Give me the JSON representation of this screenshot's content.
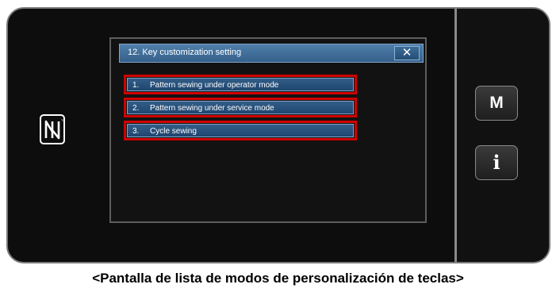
{
  "dialog": {
    "title": "12.  Key customization setting",
    "close_label": "✕"
  },
  "items": [
    {
      "number": "1.",
      "label": "Pattern sewing under operator mode"
    },
    {
      "number": "2.",
      "label": "Pattern sewing under service mode"
    },
    {
      "number": "3.",
      "label": "Cycle sewing"
    }
  ],
  "side_buttons": {
    "m_label": "M",
    "i_label": "i"
  },
  "icons": {
    "nfc": "nfc-icon"
  },
  "colors": {
    "title_bar": "#4f7fab",
    "item_fill": "#325d87",
    "highlight_border": "#d10000"
  },
  "caption": "<Pantalla de lista de modos de personalización de teclas>"
}
